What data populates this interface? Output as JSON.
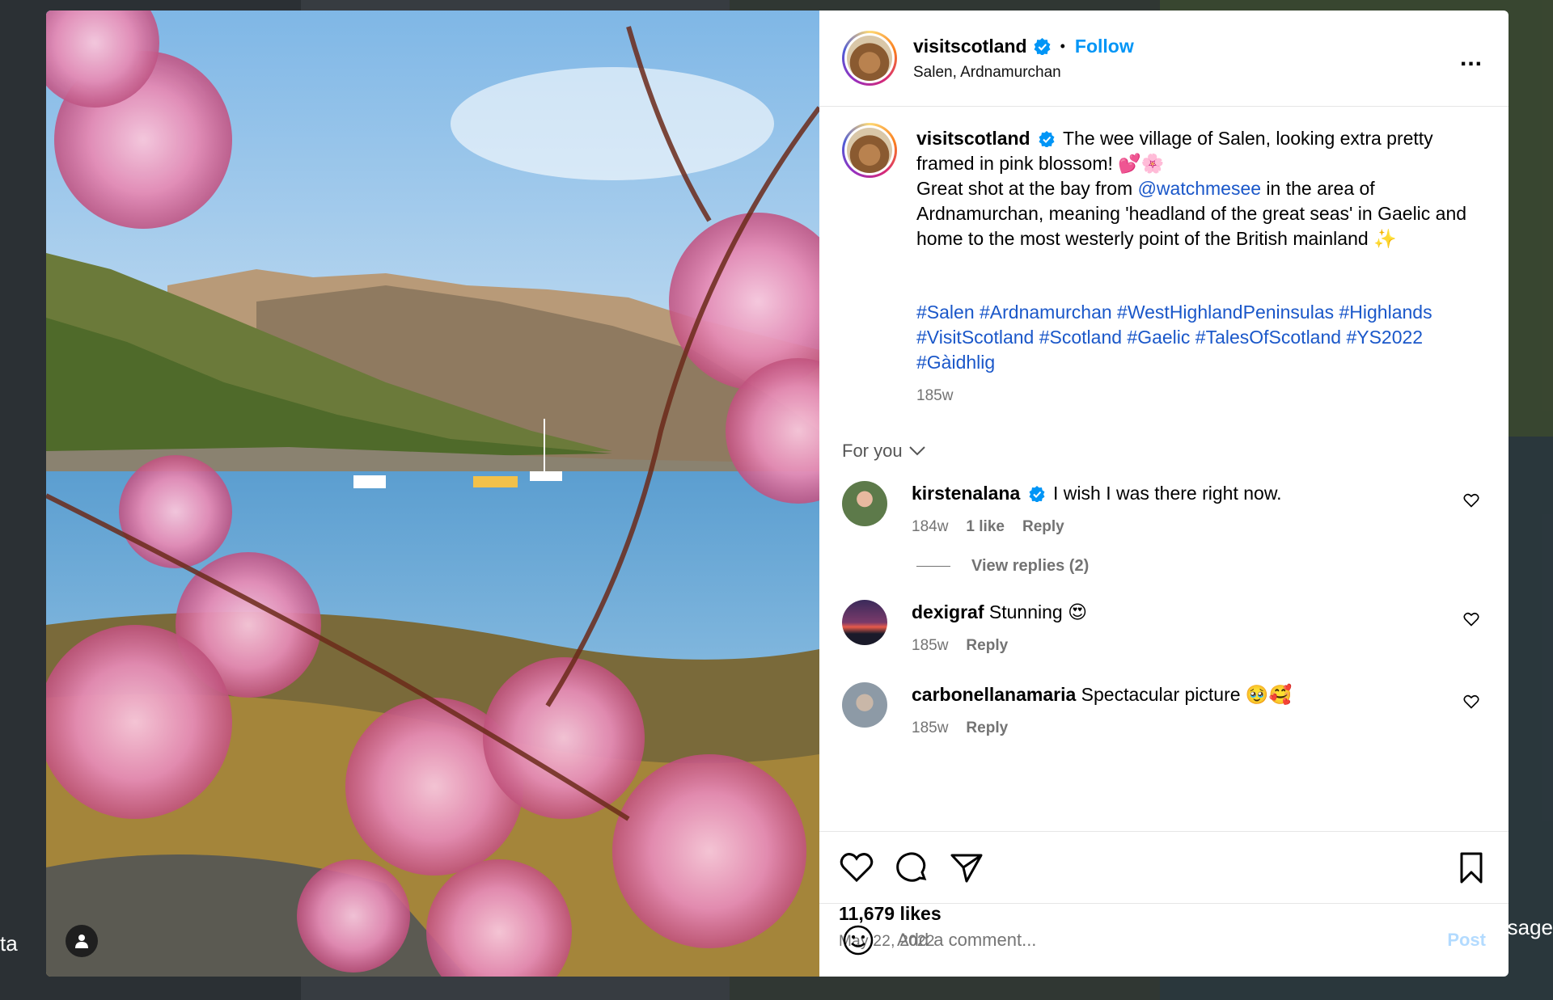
{
  "background": {
    "left_text": "ta",
    "right_text": "sage"
  },
  "post": {
    "username": "visitscotland",
    "follow_label": "Follow",
    "dot": "•",
    "location": "Salen, Ardnamurchan",
    "more_label": "...",
    "caption": {
      "text_part1": "The wee village of Salen, looking extra pretty framed in pink blossom! 💕🌸",
      "text_part2": "Great shot at the bay from ",
      "mention": "@watchmesee",
      "text_part3": " in the area of Ardnamurchan, meaning 'headland of the great seas' in Gaelic and home to the most westerly point of the British mainland ✨",
      "hashtags": "#Salen #Ardnamurchan #WestHighlandPeninsulas #Highlands #VisitScotland #Scotland #Gaelic #TalesOfScotland #YS2022 #Gàidhlig",
      "age": "185w"
    },
    "for_you_label": "For you",
    "comments": [
      {
        "username": "kirstenalana",
        "text": "I wish I was there right now.",
        "age": "184w",
        "likes": "1 like",
        "reply": "Reply",
        "view_replies": "View replies (2)"
      },
      {
        "username": "dexigraf",
        "text": "Stunning 😍",
        "age": "185w",
        "reply": "Reply"
      },
      {
        "username": "carbonellanamaria",
        "text": "Spectacular picture 🥹🥰",
        "age": "185w",
        "reply": "Reply"
      }
    ],
    "likes": "11,679 likes",
    "date": "May 22, 2022",
    "add_comment_placeholder": "Add a comment...",
    "post_label": "Post"
  },
  "colors": {
    "accent": "#0095f6",
    "hashtag": "#1a57c9",
    "muted": "#737373",
    "post_disabled": "#b3dbff"
  },
  "icons": [
    "heart-icon",
    "comment-icon",
    "share-icon",
    "bookmark-icon",
    "emoji-icon",
    "more-icon",
    "verified-icon",
    "user-tag-icon",
    "chevron-down-icon"
  ]
}
